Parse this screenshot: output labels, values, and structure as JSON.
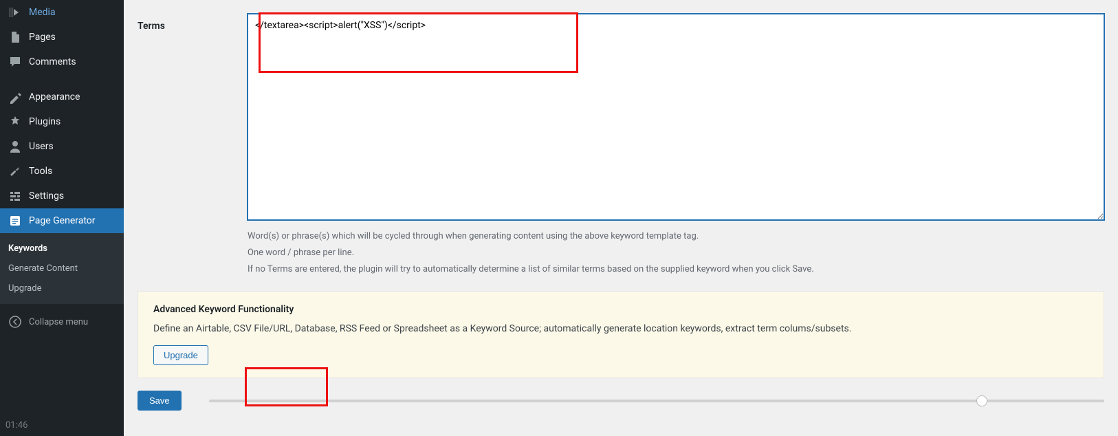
{
  "sidebar": {
    "items": [
      {
        "label": "Media"
      },
      {
        "label": "Pages"
      },
      {
        "label": "Comments"
      },
      {
        "label": "Appearance"
      },
      {
        "label": "Plugins"
      },
      {
        "label": "Users"
      },
      {
        "label": "Tools"
      },
      {
        "label": "Settings"
      },
      {
        "label": "Page Generator"
      }
    ],
    "submenu": [
      {
        "label": "Keywords"
      },
      {
        "label": "Generate Content"
      },
      {
        "label": "Upgrade"
      }
    ],
    "collapse": "Collapse menu"
  },
  "form": {
    "terms_label": "Terms",
    "terms_value": "</textarea><script>alert(\"XSS\")</script>",
    "help1": "Word(s) or phrase(s) which will be cycled through when generating content using the above keyword template tag.",
    "help2": "One word / phrase per line.",
    "help3": "If no Terms are entered, the plugin will try to automatically determine a list of similar terms based on the supplied keyword when you click Save."
  },
  "advanced": {
    "title": "Advanced Keyword Functionality",
    "desc": "Define an Airtable, CSV File/URL, Database, RSS Feed or Spreadsheet as a Keyword Source; automatically generate location keywords, extract term colums/subsets.",
    "upgrade_btn": "Upgrade"
  },
  "save_btn": "Save",
  "timecode": "01:46"
}
